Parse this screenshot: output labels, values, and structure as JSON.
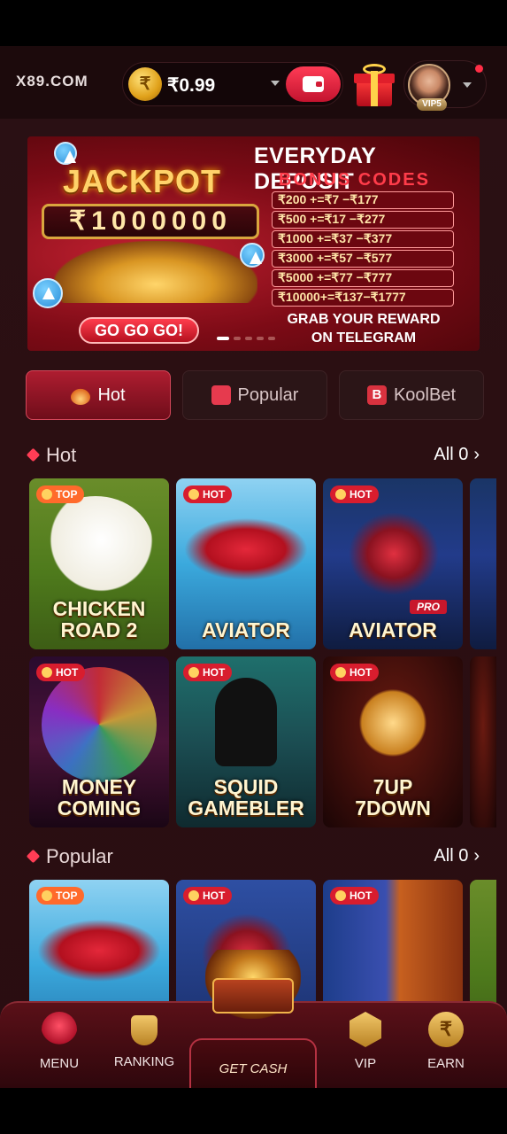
{
  "header": {
    "logo": "X89.COM",
    "currency_symbol": "₹",
    "balance": "₹0.99",
    "vip_badge": "VIP5"
  },
  "banner": {
    "jackpot_title": "JACKPOT",
    "jackpot_amount": "₹1000000",
    "cta": "GO GO GO!",
    "headline": "EVERYDAY DEPOSIT",
    "subheadline": "BONUS CODES",
    "codes": [
      "₹200 +=₹7 −₹177",
      "₹500 +=₹17 −₹277",
      "₹1000 +=₹37 −₹377",
      "₹3000 +=₹57 −₹577",
      "₹5000 +=₹77 −₹777",
      "₹10000+=₹137−₹1777"
    ],
    "footer_line1": "GRAB YOUR REWARD",
    "footer_line2": "ON TELEGRAM"
  },
  "tabs": [
    {
      "label": "Hot",
      "icon": "flame-icon",
      "active": true
    },
    {
      "label": "Popular",
      "icon": "thumbs-up-icon",
      "active": false
    },
    {
      "label": "KoolBet",
      "icon": "koolbet-logo-icon",
      "active": false
    }
  ],
  "sections": {
    "hot": {
      "title": "Hot",
      "all_label": "All 0",
      "games": [
        {
          "name_line1": "CHICKEN",
          "name_line2": "ROAD 2",
          "tag": "TOP"
        },
        {
          "name_line1": "AVIATOR",
          "name_line2": "",
          "tag": "HOT"
        },
        {
          "name_line1": "AVIATOR",
          "name_line2": "",
          "tag": "HOT",
          "badge": "PRO"
        },
        {
          "name_line1": "MONEY",
          "name_line2": "COMING",
          "tag": "HOT"
        },
        {
          "name_line1": "SQUID",
          "name_line2": "GAMEBLER",
          "tag": "HOT"
        },
        {
          "name_line1": "7UP",
          "name_line2": "7DOWN",
          "tag": "HOT"
        }
      ]
    },
    "popular": {
      "title": "Popular",
      "all_label": "All 0",
      "games": [
        {
          "tag": "TOP"
        },
        {
          "tag": "HOT"
        },
        {
          "tag": "HOT"
        }
      ]
    }
  },
  "bottom_nav": {
    "menu": "MENU",
    "ranking": "RANKING",
    "get_cash": "GET CASH",
    "vip": "VIP",
    "earn": "EARN",
    "earn_symbol": "₹"
  },
  "colors": {
    "accent": "#ff3d55",
    "background": "#2a1014",
    "active_tab": "#ae1d30"
  }
}
